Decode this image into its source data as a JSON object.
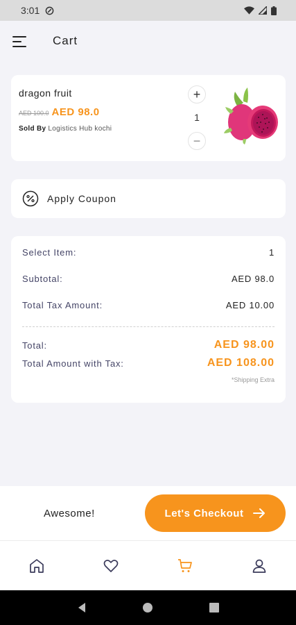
{
  "status_bar": {
    "time": "3:01"
  },
  "header": {
    "title": "Cart"
  },
  "cart_item": {
    "name": "dragon fruit",
    "old_price": "AED 100.0",
    "price": "AED 98.0",
    "sold_by_label": "Sold By",
    "seller": "Logistics Hub kochi",
    "quantity": "1",
    "plus_label": "+",
    "minus_label": "−"
  },
  "coupon": {
    "label": "Apply Coupon"
  },
  "summary": {
    "select_item_label": "Select Item:",
    "select_item_value": "1",
    "subtotal_label": "Subtotal:",
    "subtotal_value": "AED 98.0",
    "tax_label": "Total Tax Amount:",
    "tax_value": "AED 10.00",
    "total_label": "Total:",
    "total_value": "AED 98.00",
    "total_with_tax_label": "Total Amount with Tax:",
    "total_with_tax_value": "AED 108.00",
    "shipping_note": "*Shipping Extra"
  },
  "checkout": {
    "message": "Awesome!",
    "button_label": "Let's Checkout"
  },
  "bottom_nav": {
    "items": [
      "home-icon",
      "heart-icon",
      "cart-icon",
      "profile-icon"
    ],
    "active": "cart-icon"
  },
  "colors": {
    "accent": "#f7941d",
    "background": "#f3f3f8",
    "card": "#ffffff"
  }
}
